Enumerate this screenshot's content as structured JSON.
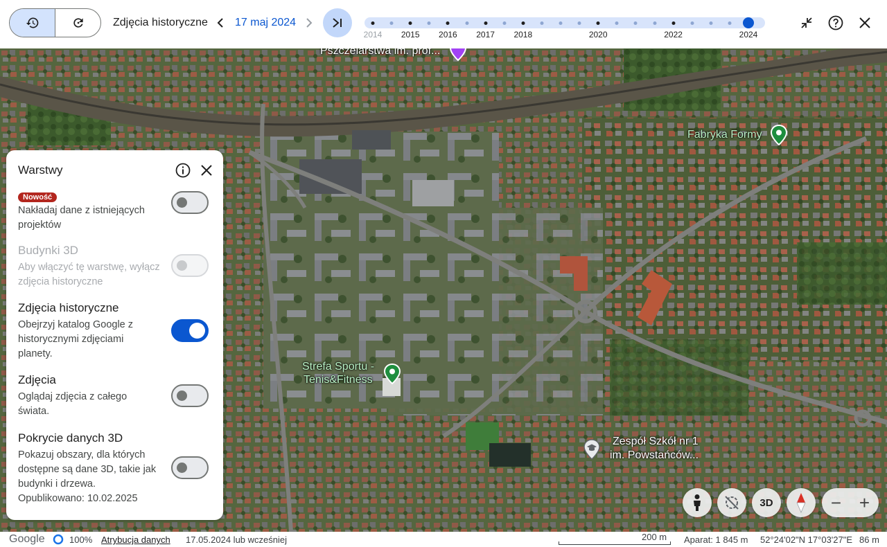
{
  "toolbar": {
    "historical_title": "Zdjęcia historyczne",
    "date": "17 maj 2024",
    "mode_history_icon": "history-icon",
    "mode_reset_icon": "refresh-icon",
    "prev_icon": "chevron-left-icon",
    "next_icon": "chevron-right-icon",
    "skip_end_icon": "skip-to-end-icon",
    "exit_icon": "collapse-icon",
    "help_icon": "help-icon",
    "close_icon": "close-icon"
  },
  "timeline": {
    "years": [
      "2014",
      "2015",
      "2016",
      "2017",
      "2018",
      "2020",
      "2022",
      "2024"
    ],
    "selected_year": "2024"
  },
  "map_labels": {
    "top_place": "Pszczelarstwa im. prof...",
    "factory": "Fabryka Formy",
    "sport_line1": "Strefa Sportu -",
    "sport_line2": "Tenis&Fitness",
    "school_line1": "Zespół Szkół nr 1",
    "school_line2": "im. Powstańców..."
  },
  "layers_panel": {
    "title": "Warstwy",
    "items": [
      {
        "badge": "Nowość",
        "title": "",
        "description": "Nakładaj dane z istniejących projektów",
        "state": "off"
      },
      {
        "title": "Budynki 3D",
        "description": "Aby włączyć tę warstwę, wyłącz zdjęcia historyczne",
        "state": "disabled"
      },
      {
        "title": "Zdjęcia historyczne",
        "description": "Obejrzyj katalog Google z historycznymi zdjęciami planety.",
        "state": "on"
      },
      {
        "title": "Zdjęcia",
        "description": "Oglądaj zdjęcia z całego świata.",
        "state": "off"
      },
      {
        "title": "Pokrycie danych 3D",
        "description": "Pokazuj obszary, dla których dostępne są dane 3D, takie jak budynki i drzewa. Opublikowano: 10.02.2025",
        "state": "off"
      }
    ]
  },
  "map_controls": {
    "pegman_icon": "pegman-icon",
    "tilt_icon": "tilt-off-icon",
    "view_3d_label": "3D",
    "compass_icon": "compass-icon",
    "zoom_out": "−",
    "zoom_in": "+"
  },
  "status_bar": {
    "logo": "Google",
    "progress": "100%",
    "attribution": "Atrybucja danych",
    "imagery_date": "17.05.2024 lub wcześniej",
    "scale": "200 m",
    "camera": "Aparat: 1 845 m",
    "coordinates": "52°24'02\"N 17°03'27\"E",
    "elevation": "86 m"
  }
}
